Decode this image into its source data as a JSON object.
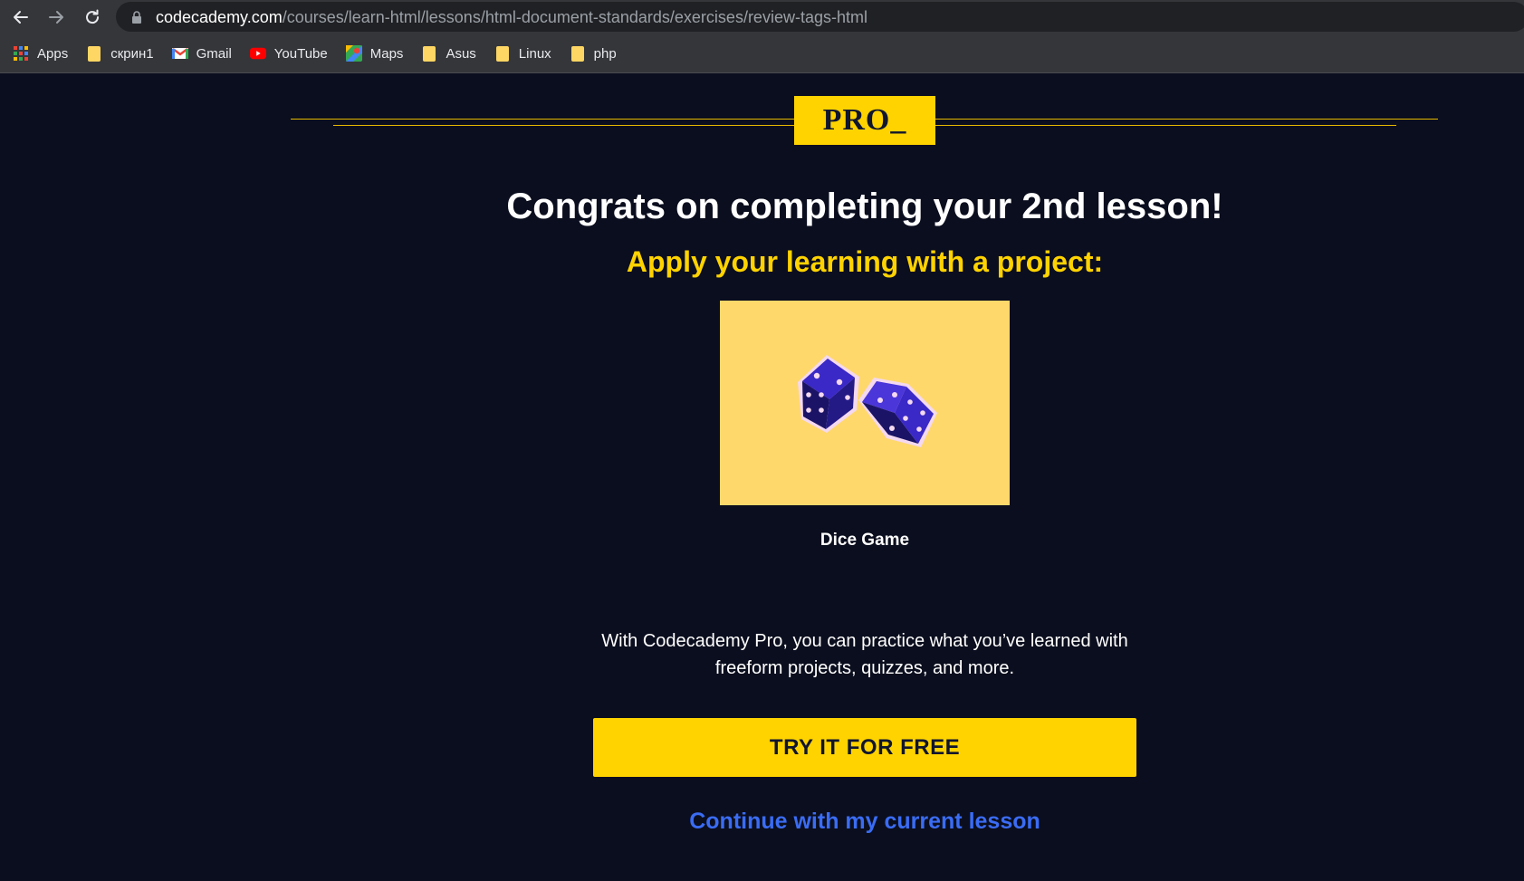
{
  "browser": {
    "url_host": "codecademy.com",
    "url_path": "/courses/learn-html/lessons/html-document-standards/exercises/review-tags-html",
    "bookmarks": [
      {
        "label": "Apps",
        "icon": "apps-grid-icon"
      },
      {
        "label": "скрин1",
        "icon": "folder-icon"
      },
      {
        "label": "Gmail",
        "icon": "gmail-icon"
      },
      {
        "label": "YouTube",
        "icon": "youtube-icon"
      },
      {
        "label": "Maps",
        "icon": "maps-icon"
      },
      {
        "label": "Asus",
        "icon": "folder-icon"
      },
      {
        "label": "Linux",
        "icon": "folder-icon"
      },
      {
        "label": "php",
        "icon": "folder-icon"
      }
    ]
  },
  "page": {
    "badge": "PRO_",
    "headline": "Congrats on completing your 2nd lesson!",
    "subhead": "Apply your learning with a project:",
    "project": {
      "title": "Dice Game",
      "image": "dice-icon"
    },
    "pitch": "With Codecademy Pro, you can practice what you’ve learned with freeform projects, quizzes, and more.",
    "cta_label": "TRY IT FOR FREE",
    "continue_label": "Continue with my current lesson"
  },
  "colors": {
    "background": "#0b0e1e",
    "accent_yellow": "#ffd300",
    "card_yellow": "#ffd86b",
    "link_blue": "#3a6cf4",
    "dice_blue": "#3a28c7",
    "dice_dark": "#1b1466"
  }
}
